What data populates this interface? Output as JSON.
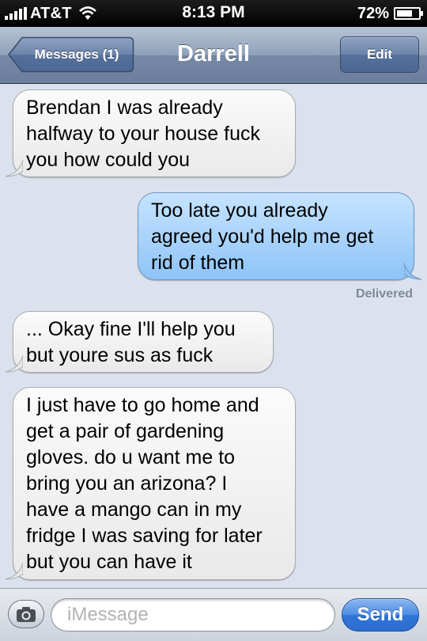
{
  "status_bar": {
    "carrier": "AT&T",
    "time": "8:13 PM",
    "battery": "72%",
    "battery_level": 0.72,
    "icons": [
      "signal-icon",
      "wifi-icon",
      "battery-charging-icon"
    ]
  },
  "nav": {
    "back_label": "Messages (1)",
    "title": "Darrell",
    "edit_label": "Edit"
  },
  "messages": [
    {
      "direction": "received",
      "lines": [
        "Brendan I was already",
        "halfway to your house fuck",
        "you how could you"
      ]
    },
    {
      "direction": "sent",
      "lines": [
        "Too late you already",
        "agreed you'd help me get",
        "rid of them"
      ]
    },
    {
      "direction": "received",
      "lines": [
        "... Okay fine I'll help you",
        "but youre sus as fuck"
      ]
    },
    {
      "direction": "received",
      "lines": [
        "I just have to go home and",
        "get a pair of gardening",
        "gloves. do u want me to",
        "bring you an arizona? I",
        "have a mango can in my",
        "fridge I was saving for later",
        "but you can have it"
      ]
    }
  ],
  "delivered_label": "Delivered",
  "composer": {
    "placeholder": "iMessage",
    "value": "",
    "send_label": "Send"
  },
  "colors": {
    "background": "#dbe2ed",
    "sent_bubble": "#8ec4f7",
    "received_bubble": "#e9e9e9",
    "send_button": "#2f74d8"
  }
}
